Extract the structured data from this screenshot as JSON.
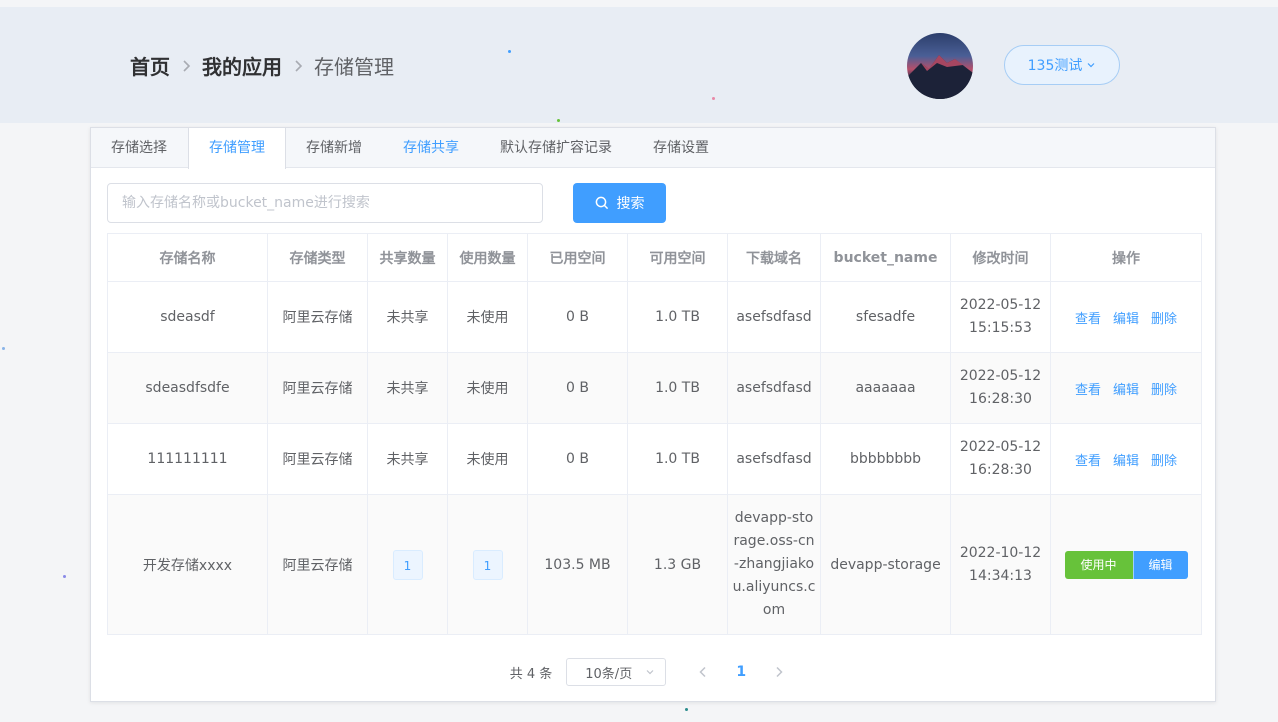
{
  "breadcrumb": {
    "home": "首页",
    "apps": "我的应用",
    "current": "存储管理"
  },
  "user": {
    "name": "135测试",
    "avatar_icon": "mountain-avatar"
  },
  "tabs": [
    {
      "label": "存储选择"
    },
    {
      "label": "存储管理"
    },
    {
      "label": "存储新增"
    },
    {
      "label": "存储共享"
    },
    {
      "label": "默认存储扩容记录"
    },
    {
      "label": "存储设置"
    }
  ],
  "search": {
    "placeholder": "输入存储名称或bucket_name进行搜索",
    "value": "",
    "button": "搜索"
  },
  "table": {
    "headers": [
      "存储名称",
      "存储类型",
      "共享数量",
      "使用数量",
      "已用空间",
      "可用空间",
      "下载域名",
      "bucket_name",
      "修改时间",
      "操作"
    ],
    "rows": [
      {
        "name": "sdeasdf",
        "type": "阿里云存储",
        "share": "未共享",
        "use": "未使用",
        "used": "0 B",
        "avail": "1.0 TB",
        "domain": "asefsdfasd",
        "bucket": "sfesadfe",
        "time": "2022-05-12 15:15:53"
      },
      {
        "name": "sdeasdfsdfe",
        "type": "阿里云存储",
        "share": "未共享",
        "use": "未使用",
        "used": "0 B",
        "avail": "1.0 TB",
        "domain": "asefsdfasd",
        "bucket": "aaaaaaa",
        "time": "2022-05-12 16:28:30"
      },
      {
        "name": "111111111",
        "type": "阿里云存储",
        "share": "未共享",
        "use": "未使用",
        "used": "0 B",
        "avail": "1.0 TB",
        "domain": "asefsdfasd",
        "bucket": "bbbbbbbb",
        "time": "2022-05-12 16:28:30"
      },
      {
        "name": "开发存储xxxx",
        "type": "阿里云存储",
        "share": "1",
        "use": "1",
        "used": "103.5 MB",
        "avail": "1.3 GB",
        "domain": "devapp-storage.oss-cn-zhangjiakou.aliyuncs.com",
        "bucket": "devapp-storage",
        "time": "2022-10-12 14:34:13"
      }
    ],
    "ops": {
      "view": "查看",
      "edit": "编辑",
      "delete": "删除",
      "in_use": "使用中"
    }
  },
  "pagination": {
    "total": "共 4 条",
    "page_size": "10条/页",
    "current": "1"
  },
  "colors": {
    "primary": "#409eff",
    "success": "#67c23a"
  }
}
